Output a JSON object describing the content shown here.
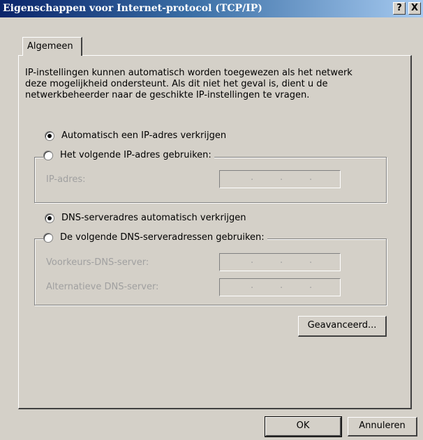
{
  "window": {
    "title": "Eigenschappen voor Internet-protocol (TCP/IP)",
    "help_button": "?",
    "close_button": "X"
  },
  "tabs": [
    {
      "label": "Algemeen",
      "selected": true
    }
  ],
  "description": "IP-instellingen kunnen automatisch worden toegewezen als het netwerk deze mogelijkheid ondersteunt. Als dit niet het geval is, dient u de netwerkbeheerder naar de geschikte IP-instellingen te vragen.",
  "ip": {
    "auto_label": "Automatisch een IP-adres verkrijgen",
    "auto_selected": true,
    "manual_label": "Het volgende IP-adres gebruiken:",
    "manual_selected": false,
    "address_label": "IP-adres:"
  },
  "dns": {
    "auto_label": "DNS-serveradres automatisch verkrijgen",
    "auto_selected": true,
    "manual_label": "De volgende DNS-serveradressen gebruiken:",
    "manual_selected": false,
    "preferred_label": "Voorkeurs-DNS-server:",
    "alternate_label": "Alternatieve DNS-server:"
  },
  "ip_dot": ".",
  "buttons": {
    "advanced": "Geavanceerd...",
    "ok": "OK",
    "cancel": "Annuleren"
  }
}
